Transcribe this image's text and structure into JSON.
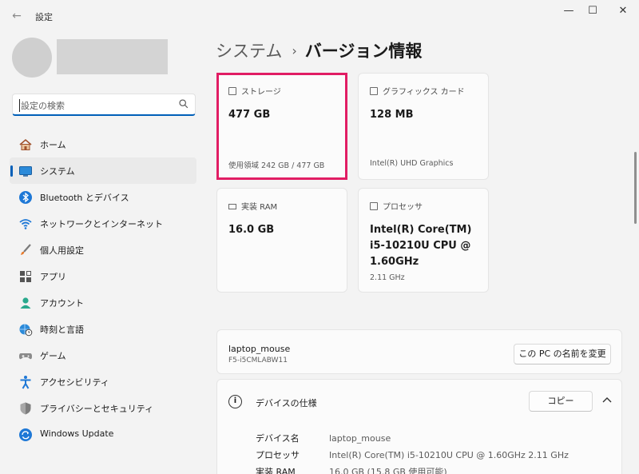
{
  "window": {
    "title": "設定",
    "back_icon": "back-arrow-icon",
    "minimize_icon": "minimize-icon",
    "maximize_icon": "maximize-icon",
    "close_icon": "close-icon"
  },
  "search": {
    "placeholder": "設定の検索",
    "icon": "search-icon"
  },
  "sidebar": {
    "items": [
      {
        "label": "ホーム",
        "icon": "home-icon",
        "active": false
      },
      {
        "label": "システム",
        "icon": "system-display-icon",
        "active": true
      },
      {
        "label": "Bluetooth とデバイス",
        "icon": "bluetooth-icon",
        "active": false
      },
      {
        "label": "ネットワークとインターネット",
        "icon": "wifi-icon",
        "active": false
      },
      {
        "label": "個人用設定",
        "icon": "brush-icon",
        "active": false
      },
      {
        "label": "アプリ",
        "icon": "apps-icon",
        "active": false
      },
      {
        "label": "アカウント",
        "icon": "account-icon",
        "active": false
      },
      {
        "label": "時刻と言語",
        "icon": "globe-clock-icon",
        "active": false
      },
      {
        "label": "ゲーム",
        "icon": "gamepad-icon",
        "active": false
      },
      {
        "label": "アクセシビリティ",
        "icon": "accessibility-icon",
        "active": false
      },
      {
        "label": "プライバシーとセキュリティ",
        "icon": "shield-icon",
        "active": false
      },
      {
        "label": "Windows Update",
        "icon": "windows-update-icon",
        "active": false
      }
    ]
  },
  "breadcrumb": {
    "parent": "システム",
    "separator": "›",
    "current": "バージョン情報"
  },
  "cards": {
    "storage": {
      "title": "ストレージ",
      "value": "477 GB",
      "sub": "使用領域 242 GB / 477 GB",
      "icon": "storage-icon"
    },
    "gpu": {
      "title": "グラフィックス カード",
      "value": "128 MB",
      "sub": "Intel(R) UHD Graphics",
      "icon": "graphics-card-icon"
    },
    "ram": {
      "title": "実装 RAM",
      "value": "16.0 GB",
      "icon": "ram-icon"
    },
    "cpu": {
      "title": "プロセッサ",
      "value_lines": [
        "Intel(R) Core(TM)",
        "i5-10210U CPU @",
        "1.60GHz"
      ],
      "sub": "2.11 GHz",
      "icon": "processor-icon"
    }
  },
  "device": {
    "name": "laptop_mouse",
    "model": "F5-i5CMLABW11",
    "rename_label": "この PC の名前を変更"
  },
  "specs": {
    "title": "デバイスの仕様",
    "info_icon": "info-icon",
    "copy_label": "コピー",
    "collapse_icon": "chevron-up-icon",
    "rows": [
      {
        "key": "デバイス名",
        "value": "laptop_mouse"
      },
      {
        "key": "プロセッサ",
        "value": "Intel(R) Core(TM) i5-10210U CPU @ 1.60GHz   2.11 GHz"
      },
      {
        "key": "実装 RAM",
        "value": "16.0 GB (15.8 GB 使用可能)"
      }
    ]
  },
  "colors": {
    "accent": "#005fb8",
    "highlight": "#e11d64",
    "background": "#f3f3f3",
    "card": "#fbfbfb"
  }
}
